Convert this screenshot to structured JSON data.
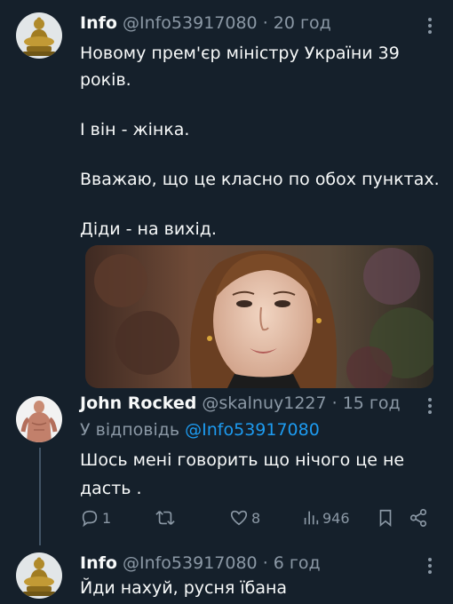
{
  "tweets": [
    {
      "name": "Info",
      "handle": "@Info53917080",
      "separator": "·",
      "time": "20 год",
      "lines": [
        "Новому прем'єр міністру України 39",
        "років.",
        "",
        "І він - жінка.",
        "",
        "Вважаю, що це класно по обох пунктах.",
        "",
        "Діди - на вихід."
      ],
      "avatar_icon": "buddha-statue-avatar",
      "media": "portrait-photo-woman"
    },
    {
      "name": "John Rocked",
      "handle": "@skalnuy1227",
      "separator": "·",
      "time": "15 год",
      "reply_prefix": "У відповідь",
      "reply_handle": "@Info53917080",
      "lines": [
        "Шось мені говорить що нічого це не",
        "дасть ."
      ],
      "avatar_icon": "shirtless-man-avatar",
      "actions": {
        "replies": "1",
        "retweets": "",
        "likes": "8",
        "views": "946"
      }
    },
    {
      "name": "Info",
      "handle": "@Info53917080",
      "separator": "·",
      "time": "6 год",
      "lines": [
        "Йди нахуй, русня їбана"
      ],
      "avatar_icon": "buddha-statue-avatar"
    }
  ],
  "colors": {
    "background": "#15202b",
    "text": "#f7f9f9",
    "secondary": "#8b98a5",
    "link": "#1d9bf0",
    "thread_line": "#425466"
  }
}
